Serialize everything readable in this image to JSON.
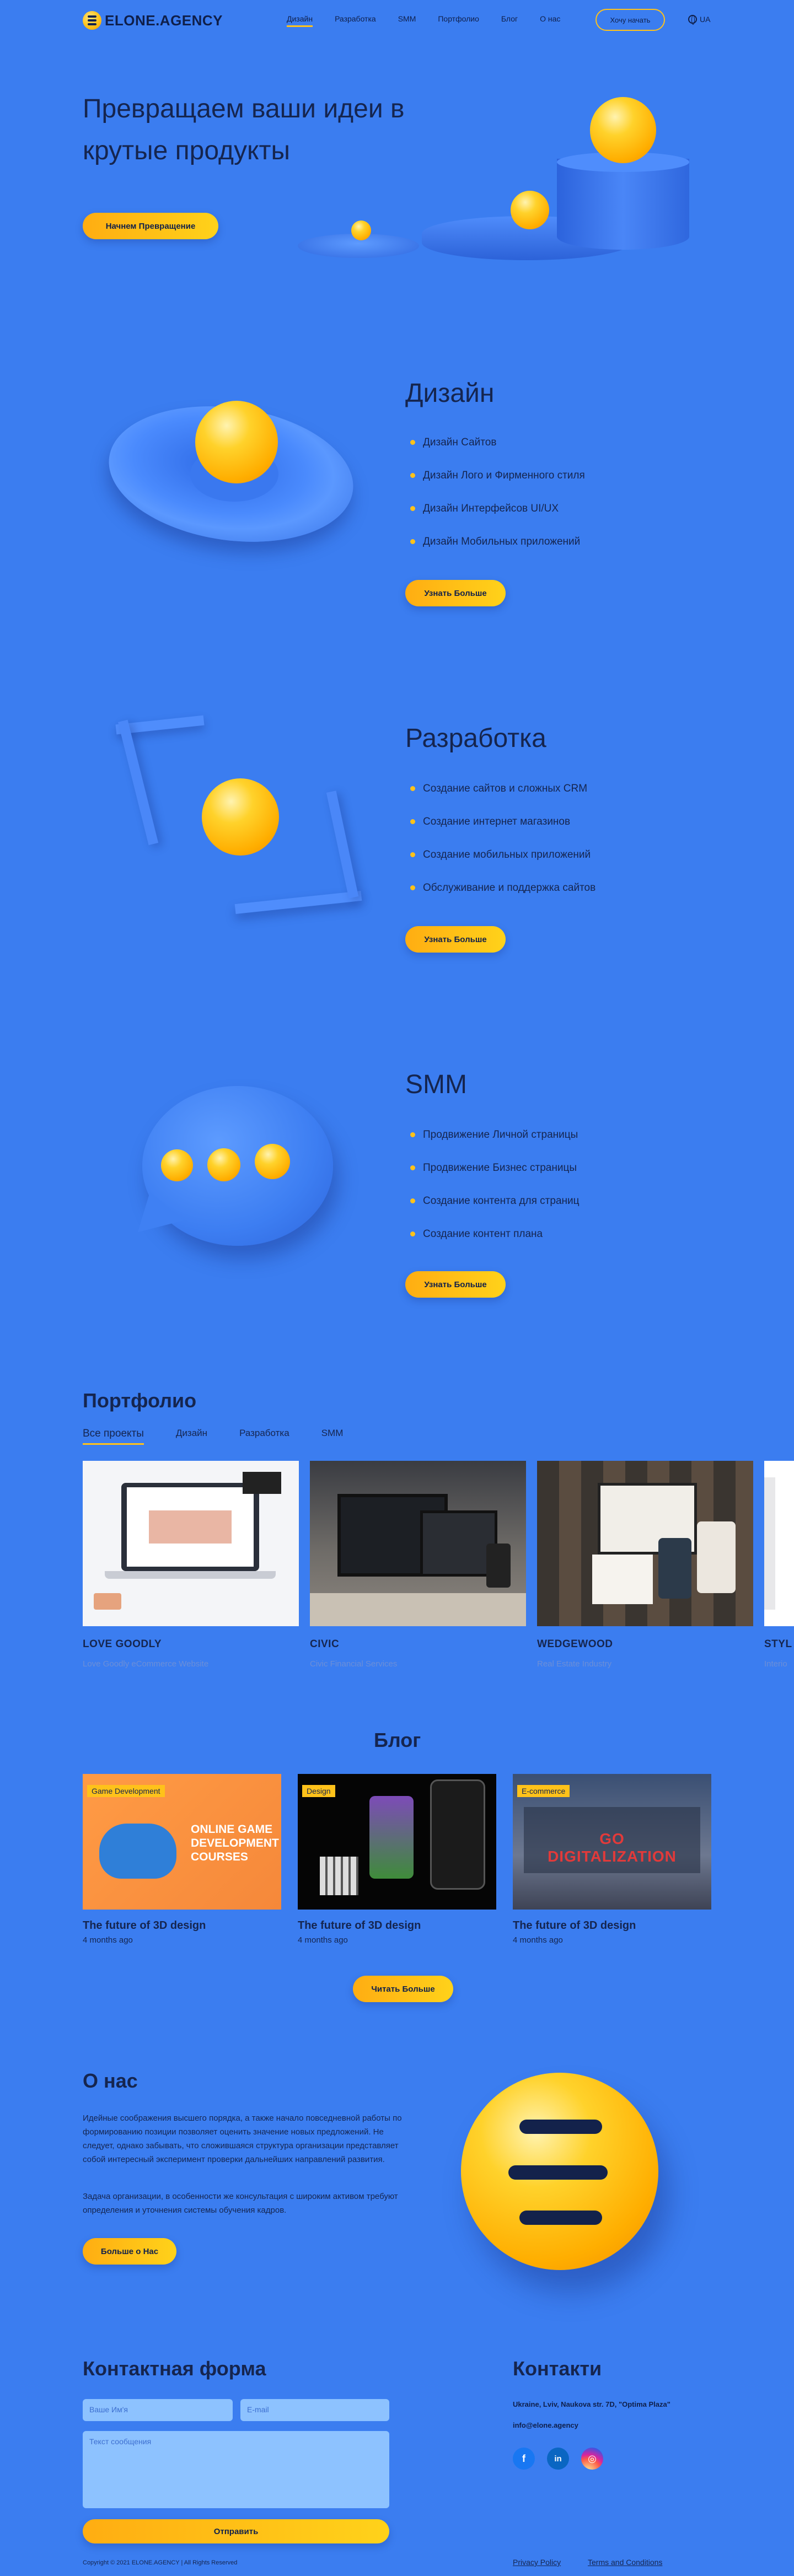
{
  "header": {
    "logo_text": "ELONE.AGENCY",
    "nav": [
      "Дизайн",
      "Разработка",
      "SMM",
      "Портфолио",
      "Блог",
      "О нас"
    ],
    "cta": "Хочу начать",
    "lang": "UA"
  },
  "hero": {
    "title": "Превращаем ваши идеи в крутые продукты",
    "button": "Начнем Превращение"
  },
  "services": [
    {
      "title": "Дизайн",
      "items": [
        "Дизайн Сайтов",
        "Дизайн Лого и Фирменного стиля",
        "Дизайн Интерфейсов UI/UX",
        "Дизайн Мобильных приложений"
      ],
      "button": "Узнать Больше"
    },
    {
      "title": "Разработка",
      "items": [
        "Создание сайтов и сложных CRM",
        "Создание интернет магазинов",
        "Создание мобильных приложений",
        "Обслуживание и поддержка сайтов"
      ],
      "button": "Узнать Больше"
    },
    {
      "title": "SMM",
      "items": [
        "Продвижение Личной страницы",
        "Продвижение Бизнес страницы",
        "Создание контента для страниц",
        "Создание контент плана"
      ],
      "button": "Узнать Больше"
    }
  ],
  "portfolio": {
    "title": "Портфолио",
    "tabs": [
      "Все проекты",
      "Дизайн",
      "Разработка",
      "SMM"
    ],
    "items": [
      {
        "title": "LOVE GOODLY",
        "subtitle": "Love Goodly eCommerce Website"
      },
      {
        "title": "CIVIC",
        "subtitle": "Civic Financial Services"
      },
      {
        "title": "WEDGEWOOD",
        "subtitle": "Real Estate Industry"
      },
      {
        "title": "STYL",
        "subtitle": "Interio"
      }
    ]
  },
  "blog": {
    "title": "Блог",
    "posts": [
      {
        "tag": "Game Development",
        "image_text": "ONLINE GAME DEVELOPMENT COURSES",
        "title": "The future of 3D design",
        "date": "4 months ago"
      },
      {
        "tag": "Design",
        "title": "The future of 3D design",
        "date": "4 months ago"
      },
      {
        "tag": "E-commerce",
        "image_text": "GO DIGITALIZATION",
        "title": "The future of 3D design",
        "date": "4 months ago"
      }
    ],
    "button": "Читать Больше"
  },
  "about": {
    "title": "О нас",
    "p1": "Идейные соображения высшего порядка, а также начало повседневной работы по формированию позиции позволяет оценить значение новых предложений. Не следует, однако забывать, что сложившаяся структура организации представляет собой интересный эксперимент проверки дальнейших направлений развития.",
    "p2": "Задача организации, в особенности же консультация с широким активом требуют определения и уточнения системы обучения кадров.",
    "button": "Больше о Нас"
  },
  "contact_form": {
    "title": "Контактная форма",
    "name_placeholder": "Ваше Им'я",
    "email_placeholder": "E-mail",
    "message_placeholder": "Текст сообщения",
    "submit": "Отправить"
  },
  "contacts": {
    "title": "Контакти",
    "address": "Ukraine, Lviv, Naukova str. 7D, \"Optima Plaza\"",
    "email": "info@elone.agency",
    "social": [
      "facebook",
      "linkedin",
      "instagram"
    ]
  },
  "footer": {
    "copyright": "Copyright © 2021 ELONE.AGENCY | All Rights Reserved",
    "privacy": "Privacy Policy",
    "terms": "Terms and Conditions"
  },
  "colors": {
    "background": "#3b7df0",
    "accent": "#ffc21a",
    "text": "#15254f"
  }
}
